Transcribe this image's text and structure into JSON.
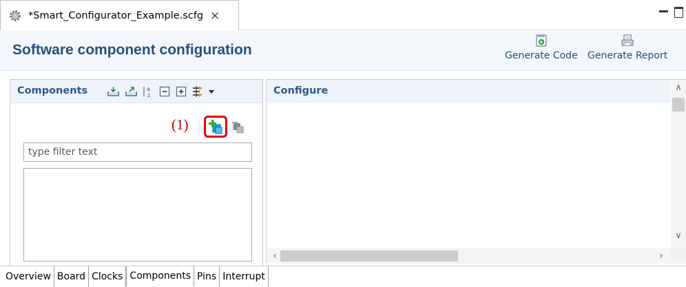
{
  "editor_tab": {
    "title": "*Smart_Configurator_Example.scfg",
    "close": "×",
    "icon": "gear-icon"
  },
  "window_controls": {
    "minimize_icon": "minimize-icon",
    "maximize_icon": "maximize-icon"
  },
  "header": {
    "title": "Software component configuration",
    "generate_code": "Generate Code",
    "generate_report": "Generate Report"
  },
  "components": {
    "title": "Components",
    "toolbar_icons": [
      "import-icon",
      "export-icon",
      "sort-az-icon",
      "collapse-all-icon",
      "expand-all-icon",
      "view-mode-icon",
      "view-menu-icon"
    ],
    "marker": "(1)",
    "add_icon": "add-component-icon",
    "remove_icon": "remove-component-icon",
    "filter_placeholder": "type filter text"
  },
  "configure": {
    "title": "Configure"
  },
  "bottom_tabs": {
    "items": [
      "Overview",
      "Board",
      "Clocks",
      "Components",
      "Pins",
      "Interrupt"
    ],
    "active": "Components"
  },
  "colors": {
    "title_blue": "#27507c",
    "panel_title": "#2c5987",
    "header_bg": "#f3f7fc",
    "marker_red": "#c00000",
    "highlight_red": "#e00000"
  }
}
